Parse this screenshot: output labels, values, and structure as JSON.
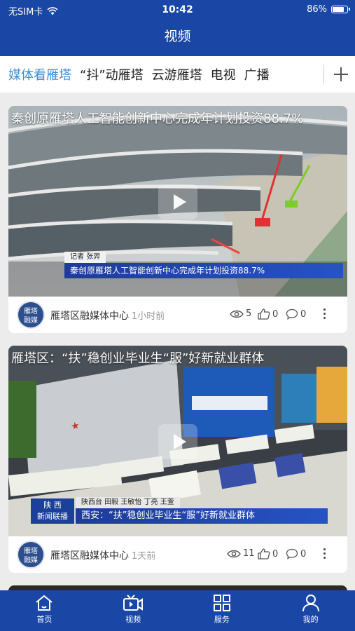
{
  "status_bar": {
    "carrier": "无SIM卡",
    "time": "10:42",
    "battery": "86%",
    "battery_level": 0.86
  },
  "header": {
    "title": "视频"
  },
  "tabs": [
    {
      "label": "媒体看雁塔",
      "active": true
    },
    {
      "label": "“抖”动雁塔",
      "active": false
    },
    {
      "label": "云游雁塔",
      "active": false
    },
    {
      "label": "电视",
      "active": false
    },
    {
      "label": "广播",
      "active": false
    }
  ],
  "videos": [
    {
      "title": "秦创原雁塔人工智能创新中心完成年计划投资88.7%",
      "thumb_reporter": "记者  张羿",
      "thumb_caption": "秦创原雁塔人工智能创新中心完成年计划投资88.7%",
      "source": "雁塔区融媒体中心",
      "time": "1小时前",
      "views": "5",
      "likes": "0",
      "comments": "0"
    },
    {
      "title": "雁塔区：“扶”稳创业毕业生“服”好新就业群体",
      "thumb_badge": "陕 西\n新闻联播",
      "thumb_reporter": "陕西台 田毅 王敏怡 丁亮 王萱",
      "thumb_caption": "西安：“扶”稳创业毕业生“服”好新就业群体",
      "source": "雁塔区融媒体中心",
      "time": "1天前",
      "views": "11",
      "likes": "0",
      "comments": "0"
    }
  ],
  "source_logo": {
    "line1": "雁塔",
    "line2": "融媒"
  },
  "tabbar": [
    {
      "label": "首页",
      "icon": "home-icon"
    },
    {
      "label": "视频",
      "icon": "video-icon"
    },
    {
      "label": "服务",
      "icon": "grid-icon"
    },
    {
      "label": "我的",
      "icon": "user-icon"
    }
  ],
  "colors": {
    "brand": "#1a47a6",
    "active_tab": "#3c8ed6"
  }
}
